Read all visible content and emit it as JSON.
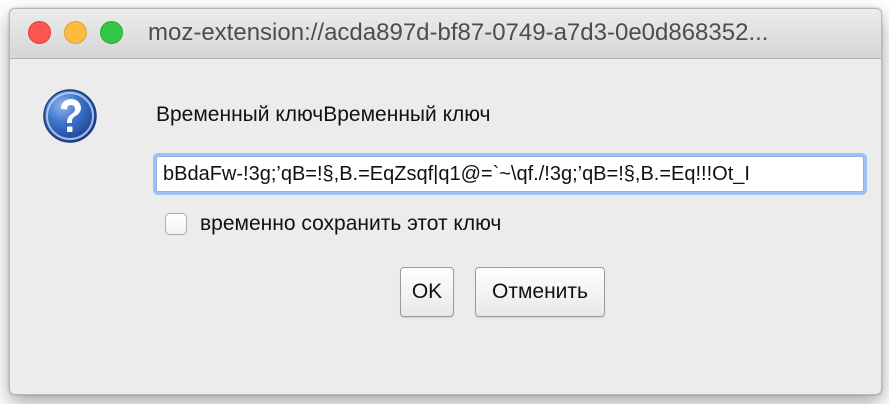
{
  "window": {
    "title": "moz-extension://acda897d-bf87-0749-a7d3-0e0d868352...",
    "controls": [
      "close",
      "minimize",
      "zoom"
    ]
  },
  "dialog": {
    "icon": "question-mark-icon",
    "prompt_label": "Временный ключВременный ключ",
    "key_value": "bBdaFw-!3g;’qB=!§,B.=EqZsqf|q1@=`~\\qf./!3g;’qB=!§,B.=Eq!!!Ot_I",
    "save_checkbox": {
      "label": "временно сохранить этот ключ",
      "checked": false
    },
    "buttons": {
      "ok_label": "OK",
      "cancel_label": "Отменить"
    }
  },
  "colors": {
    "close": "#fc5753",
    "minimize": "#fdbc40",
    "zoom": "#33c748",
    "focus_ring": "#9fc2f3",
    "dialog_bg": "#ececec"
  }
}
